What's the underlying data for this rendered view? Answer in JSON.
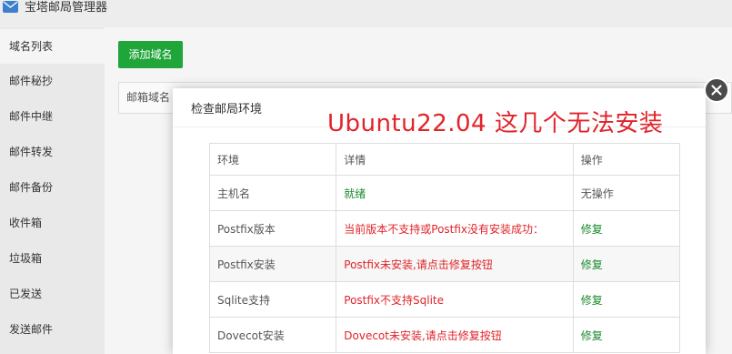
{
  "app": {
    "title": "宝塔邮局管理器",
    "icon": "mail-icon"
  },
  "sidebar": {
    "items": [
      {
        "label": "域名列表"
      },
      {
        "label": "邮件秘抄"
      },
      {
        "label": "邮件中继"
      },
      {
        "label": "邮件转发"
      },
      {
        "label": "邮件备份"
      },
      {
        "label": "收件箱"
      },
      {
        "label": "垃圾箱"
      },
      {
        "label": "已发送"
      },
      {
        "label": "发送邮件"
      }
    ]
  },
  "main": {
    "add_button": "添加域名",
    "column_header": "邮箱域名"
  },
  "dialog": {
    "title": "检查邮局环境",
    "annotation": "Ubuntu22.04 这几个无法安装",
    "headers": [
      "环境",
      "详情",
      "操作"
    ],
    "rows": [
      {
        "env": "主机名",
        "detail": "就绪",
        "action": "无操作"
      },
      {
        "env": "Postfix版本",
        "detail": "当前版本不支持或Postfix没有安装成功：",
        "action": "修复"
      },
      {
        "env": "Postfix安装",
        "detail": "Postfix未安装,请点击修复按钮",
        "action": "修复"
      },
      {
        "env": "Sqlite支持",
        "detail": "Postfix不支持Sqlite",
        "action": "修复"
      },
      {
        "env": "Dovecot安装",
        "detail": "Dovecot未安装,请点击修复按钮",
        "action": "修复"
      }
    ]
  },
  "colors": {
    "accent": "#20a53a",
    "error": "#e0242a",
    "ok": "#1a8a2e"
  }
}
